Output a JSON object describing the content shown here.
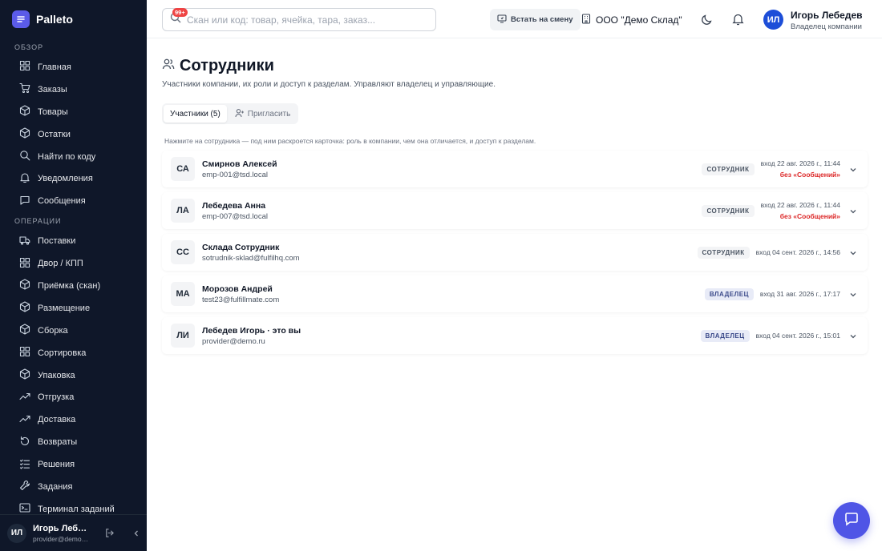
{
  "app": {
    "name": "Palleto"
  },
  "colors": {
    "sidebar_bg": "#0f1729",
    "accent": "#4f55e6",
    "brand": "#5b5be8",
    "warning": "#dc2626"
  },
  "sidebar": {
    "sections": [
      {
        "title": "ОБЗОР",
        "items": [
          {
            "label": "Главная",
            "icon": "dashboard-icon"
          },
          {
            "label": "Заказы",
            "icon": "cart-icon"
          },
          {
            "label": "Товары",
            "icon": "box-icon"
          },
          {
            "label": "Остатки",
            "icon": "box-icon"
          },
          {
            "label": "Найти по коду",
            "icon": "search-icon"
          },
          {
            "label": "Уведомления",
            "icon": "bell-icon"
          },
          {
            "label": "Сообщения",
            "icon": "chat-icon"
          }
        ]
      },
      {
        "title": "ОПЕРАЦИИ",
        "items": [
          {
            "label": "Поставки",
            "icon": "truck-icon"
          },
          {
            "label": "Двор / КПП",
            "icon": "grid-icon"
          },
          {
            "label": "Приёмка (скан)",
            "icon": "box-icon"
          },
          {
            "label": "Размещение",
            "icon": "box-icon"
          },
          {
            "label": "Сборка",
            "icon": "box-icon"
          },
          {
            "label": "Сортировка",
            "icon": "grid-icon"
          },
          {
            "label": "Упаковка",
            "icon": "box-icon"
          },
          {
            "label": "Отгрузка",
            "icon": "trend-icon"
          },
          {
            "label": "Доставка",
            "icon": "trend-icon"
          },
          {
            "label": "Возвраты",
            "icon": "return-icon"
          },
          {
            "label": "Решения",
            "icon": "list-check-icon"
          },
          {
            "label": "Задания",
            "icon": "wrench-icon"
          },
          {
            "label": "Терминал заданий",
            "icon": "terminal-icon"
          }
        ]
      }
    ],
    "footer": {
      "initials": "ИЛ",
      "name": "Игорь Лебедев",
      "email": "provider@demo.ru"
    }
  },
  "topbar": {
    "search_placeholder": "Скан или код: товар, ячейка, тара, заказ...",
    "shift_button": "Встать на смену",
    "company": "ООО \"Демо Склад\"",
    "notifications_badge": "99+",
    "user": {
      "initials": "ИЛ",
      "name": "Игорь Лебедев",
      "role": "Владелец компании"
    }
  },
  "page": {
    "title": "Сотрудники",
    "subtitle": "Участники компании, их роли и доступ к разделам. Управляют владелец и управляющие.",
    "tabs": [
      {
        "label": "Участники (5)",
        "active": true
      },
      {
        "label": "Пригласить",
        "active": false
      }
    ],
    "hint": "Нажмите на сотрудника — под ним раскроется карточка: роль в компании, чем она отличается, и доступ к разделам.",
    "members": [
      {
        "initials": "СА",
        "name": "Смирнов Алексей",
        "email": "emp-001@tsd.local",
        "role": "СОТРУДНИК",
        "role_type": "employee",
        "login": "вход 22 авг. 2026 г., 11:44",
        "warning": "без «Сообщений»"
      },
      {
        "initials": "ЛА",
        "name": "Лебедева Анна",
        "email": "emp-007@tsd.local",
        "role": "СОТРУДНИК",
        "role_type": "employee",
        "login": "вход 22 авг. 2026 г., 11:44",
        "warning": "без «Сообщений»"
      },
      {
        "initials": "СС",
        "name": "Склада Сотрудник",
        "email": "sotrudnik-sklad@fulfilhq.com",
        "role": "СОТРУДНИК",
        "role_type": "employee",
        "login": "вход 04 сент. 2026 г., 14:56",
        "warning": ""
      },
      {
        "initials": "МА",
        "name": "Морозов Андрей",
        "email": "test23@fulfillmate.com",
        "role": "ВЛАДЕЛЕЦ",
        "role_type": "owner",
        "login": "вход 31 авг. 2026 г., 17:17",
        "warning": ""
      },
      {
        "initials": "ЛИ",
        "name": "Лебедев Игорь · это вы",
        "email": "provider@demo.ru",
        "role": "ВЛАДЕЛЕЦ",
        "role_type": "owner",
        "login": "вход 04 сент. 2026 г., 15:01",
        "warning": ""
      }
    ]
  }
}
